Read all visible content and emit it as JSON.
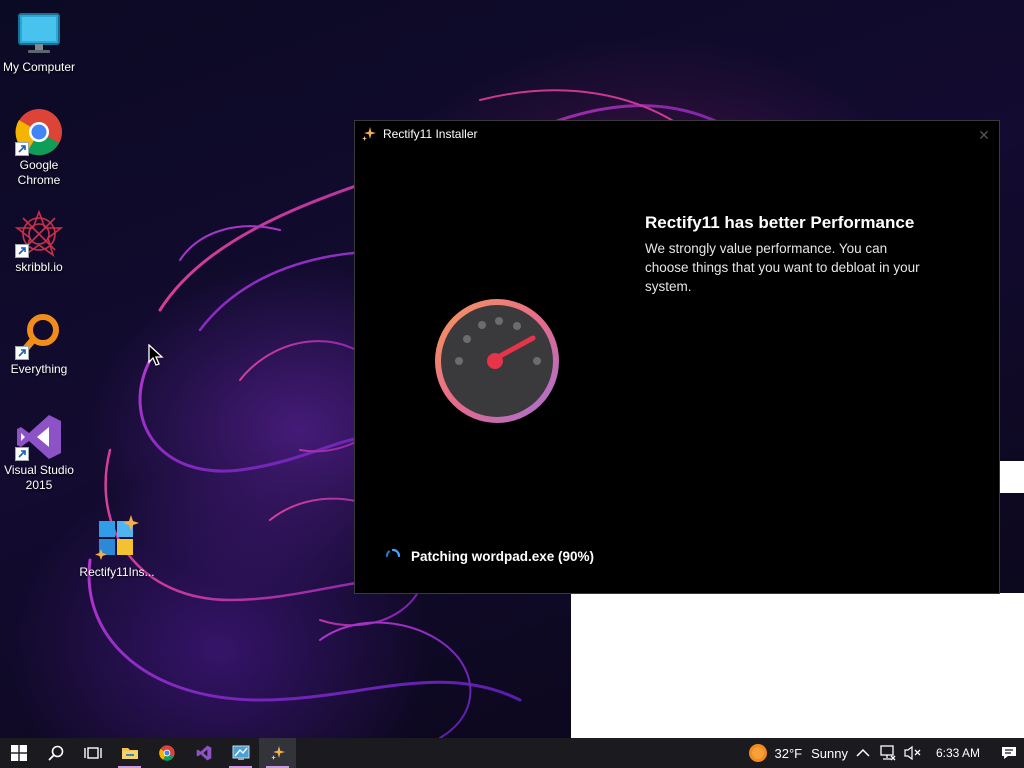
{
  "desktop": {
    "icons": [
      {
        "label": "My Computer",
        "icon": "computer-icon"
      },
      {
        "label": "Google Chrome",
        "icon": "chrome-icon"
      },
      {
        "label": "skribbl.io",
        "icon": "skribbl-icon"
      },
      {
        "label": "Everything",
        "icon": "everything-search-icon"
      },
      {
        "label": "Visual Studio 2015",
        "icon": "visual-studio-icon"
      },
      {
        "label": "Rectify11Ins...",
        "icon": "rectify11-installer-icon"
      }
    ]
  },
  "installer": {
    "title": "Rectify11 Installer",
    "close_glyph": "✕",
    "feature_title": "Rectify11 has better Performance",
    "feature_description": "We strongly value performance. You can choose things that you want to debloat in your system.",
    "status": "Patching wordpad.exe (90%)",
    "progress_percent": 90
  },
  "taskbar": {
    "apps": [
      "start-button",
      "search",
      "task-view",
      "file-explorer",
      "chrome",
      "visual-studio",
      "control-panel",
      "rectify11-installer"
    ],
    "weather": {
      "temperature": "32°F",
      "condition": "Sunny"
    },
    "clock": "6:33 AM"
  },
  "colors": {
    "taskbar": "#1b1b1f",
    "window_bg": "#000000",
    "accent_purple": "#9d4fd6",
    "gauge_needle": "#e8344b"
  }
}
